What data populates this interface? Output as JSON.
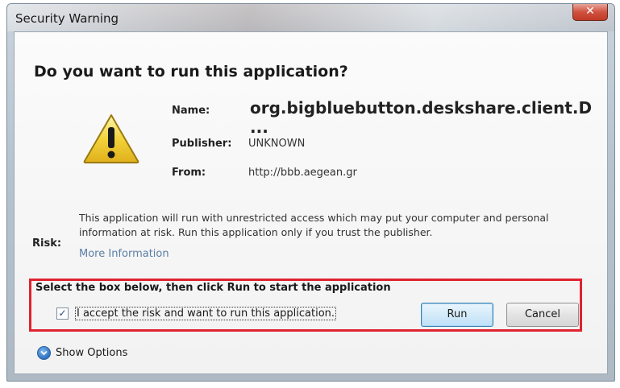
{
  "window": {
    "title": "Security Warning",
    "close_glyph": "✕"
  },
  "dialog": {
    "heading": "Do you want to run this application?",
    "fields": {
      "name_label": "Name:",
      "name_value": "org.bigbluebutton.deskshare.client.D ...",
      "publisher_label": "Publisher:",
      "publisher_value": "UNKNOWN",
      "from_label": "From:",
      "from_value": "http://bbb.aegean.gr"
    },
    "risk_label": "Risk:",
    "risk_text": "This application will run with unrestricted access which may put your computer and personal information at risk. Run this application only if you trust the publisher.",
    "more_info": "More Information",
    "instruction": "Select the box below, then click Run to start the application",
    "checkbox": {
      "label": "I accept the risk and want to run this application.",
      "checked": true,
      "check_glyph": "✓"
    },
    "run_button": "Run",
    "cancel_button": "Cancel",
    "show_options": "Show Options"
  },
  "icons": {
    "warning": "warning-icon",
    "show_options": "chevron-down-icon"
  },
  "colors": {
    "highlight": "#e0232f",
    "close_button": "#c03a27",
    "warning_yellow": "#f2d33a",
    "link": "#5b7fa6"
  }
}
